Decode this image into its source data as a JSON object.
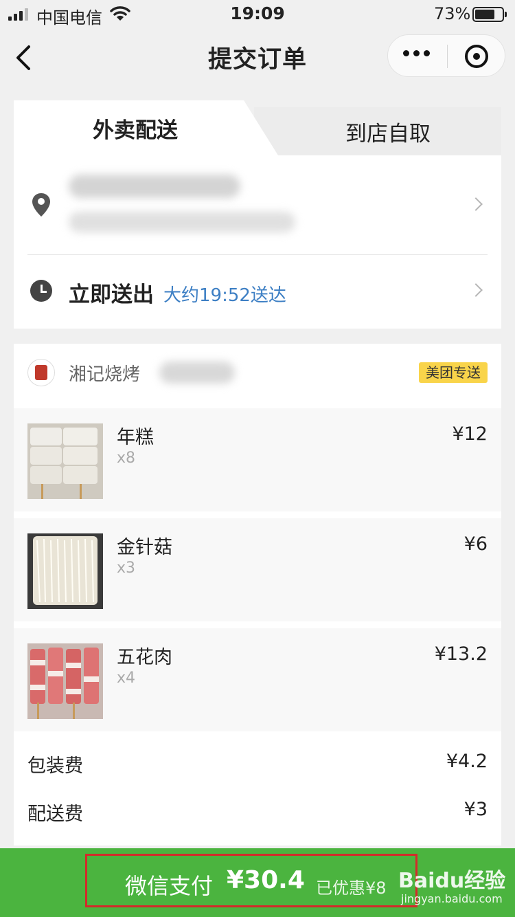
{
  "status_bar": {
    "carrier": "中国电信",
    "time": "19:09",
    "battery": "73%",
    "battery_level": 0.73
  },
  "nav": {
    "title": "提交订单"
  },
  "tabs": {
    "active": "外卖配送",
    "inactive": "到店自取"
  },
  "delivery": {
    "deliver_now": "立即送出",
    "eta": "大约19:52送达"
  },
  "shop": {
    "name": "湘记烧烤",
    "badge": "美团专送"
  },
  "items": [
    {
      "name": "年糕",
      "qty": "x8",
      "price": "¥12"
    },
    {
      "name": "金针菇",
      "qty": "x3",
      "price": "¥6"
    },
    {
      "name": "五花肉",
      "qty": "x4",
      "price": "¥13.2"
    }
  ],
  "fees": [
    {
      "label": "包装费",
      "value": "¥4.2"
    },
    {
      "label": "配送费",
      "value": "¥3"
    }
  ],
  "pay": {
    "label": "微信支付",
    "amount": "¥30.4",
    "discount": "已优惠¥8"
  },
  "watermark": {
    "main": "Baidu经验",
    "sub": "jingyan.baidu.com"
  },
  "colors": {
    "pay_green": "#4bb43f",
    "eta_blue": "#3d7fc4",
    "badge_yellow": "#f9d44a",
    "highlight_red": "#d42a2a"
  }
}
